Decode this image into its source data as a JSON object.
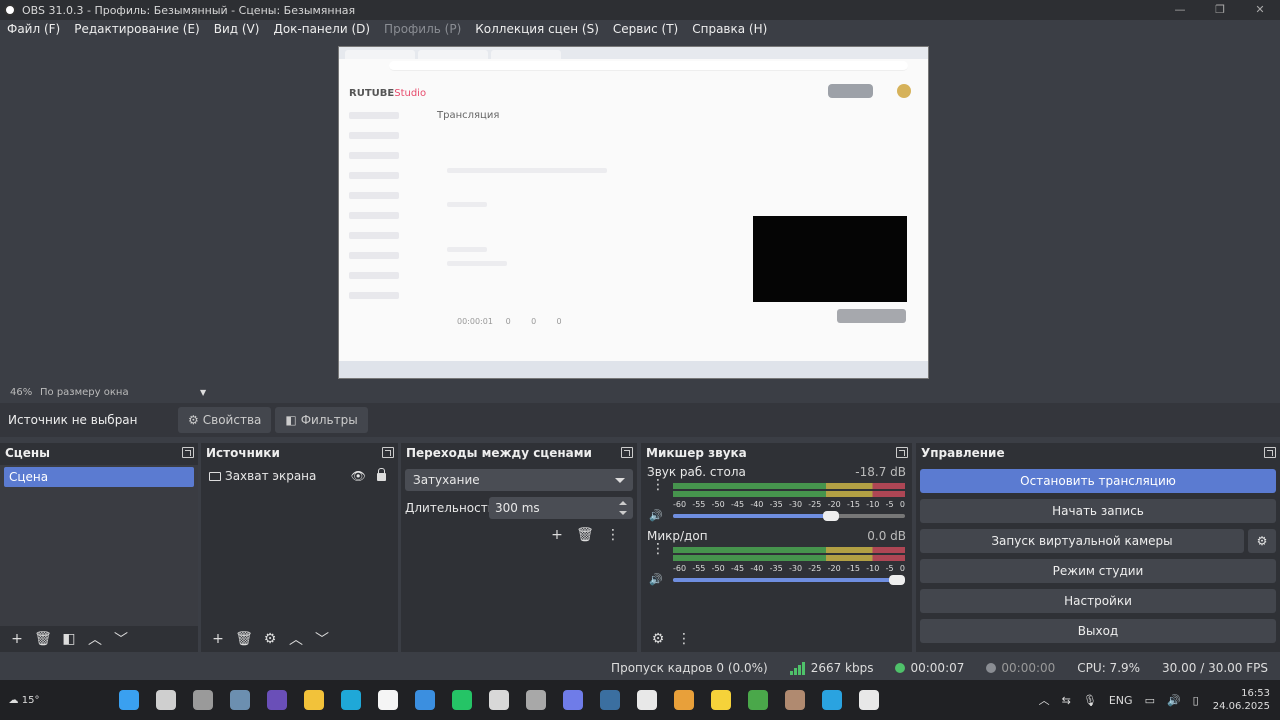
{
  "window": {
    "title": "OBS 31.0.3 - Профиль: Безымянный - Сцены: Безымянная",
    "minimize": "—",
    "maximize": "❐",
    "close": "✕"
  },
  "menu": [
    {
      "label": "Файл (F)",
      "disabled": false
    },
    {
      "label": "Редактирование (E)",
      "disabled": false
    },
    {
      "label": "Вид (V)",
      "disabled": false
    },
    {
      "label": "Док-панели (D)",
      "disabled": false
    },
    {
      "label": "Профиль (P)",
      "disabled": true
    },
    {
      "label": "Коллекция сцен (S)",
      "disabled": false
    },
    {
      "label": "Сервис (T)",
      "disabled": false
    },
    {
      "label": "Справка (H)",
      "disabled": false
    }
  ],
  "preview": {
    "logo_main": "RUTUBE",
    "logo_accent": "Studio",
    "heading": "Трансляция",
    "timer": "00:00:01",
    "counters": [
      "0",
      "0",
      "0"
    ]
  },
  "zoom": {
    "percent": "46%",
    "mode": "По размеру окна"
  },
  "source_bar": {
    "no_source": "Источник не выбран",
    "properties": "Свойства",
    "filters": "Фильтры"
  },
  "scenes": {
    "title": "Сцены",
    "items": [
      "Сцена"
    ]
  },
  "sources": {
    "title": "Источники",
    "items": [
      "Захват экрана"
    ]
  },
  "transitions": {
    "title": "Переходы между сценами",
    "selected": "Затухание",
    "duration_label": "Длительность",
    "duration_value": "300 ms"
  },
  "mixer": {
    "title": "Микшер звука",
    "ticks": [
      "-60",
      "-55",
      "-50",
      "-45",
      "-40",
      "-35",
      "-30",
      "-25",
      "-20",
      "-15",
      "-10",
      "-5",
      "0"
    ],
    "channels": [
      {
        "name": "Звук раб. стола",
        "db": "-18.7 dB",
        "volume": 0.68
      },
      {
        "name": "Микр/доп",
        "db": "0.0 dB",
        "volume": 1.0
      }
    ]
  },
  "controls": {
    "title": "Управление",
    "stop_stream": "Остановить трансляцию",
    "start_record": "Начать запись",
    "virtual_cam": "Запуск виртуальной камеры",
    "studio_mode": "Режим студии",
    "settings": "Настройки",
    "exit": "Выход"
  },
  "status": {
    "dropped": "Пропуск кадров 0 (0.0%)",
    "bitrate": "2667 kbps",
    "stream_time": "00:00:07",
    "record_time": "00:00:00",
    "cpu": "CPU: 7.9%",
    "fps": "30.00 / 30.00 FPS",
    "stream_color": "#4fc16a",
    "record_color": "#8a8d93"
  },
  "taskbar": {
    "temperature": "15°",
    "lang": "ENG",
    "time": "16:53",
    "date": "24.06.2025",
    "apps": [
      {
        "name": "start-icon",
        "color": "#3aa0f0"
      },
      {
        "name": "search-icon",
        "color": "#cfcfcf"
      },
      {
        "name": "task-view-icon",
        "color": "#9a9a9a"
      },
      {
        "name": "app-icon-1",
        "color": "#6c8fb0"
      },
      {
        "name": "app-icon-2",
        "color": "#6a4fb8"
      },
      {
        "name": "folder-icon",
        "color": "#f2c23a"
      },
      {
        "name": "edge-icon",
        "color": "#1fa8d8"
      },
      {
        "name": "yandex-icon",
        "color": "#f5f5f5"
      },
      {
        "name": "store-icon",
        "color": "#3b8fe0"
      },
      {
        "name": "whatsapp-icon",
        "color": "#25c466"
      },
      {
        "name": "app-icon-3",
        "color": "#d8d8d8"
      },
      {
        "name": "app-icon-4",
        "color": "#a8a8a8"
      },
      {
        "name": "discord-icon",
        "color": "#6f7ce8"
      },
      {
        "name": "steam-icon",
        "color": "#3b6fa0"
      },
      {
        "name": "app-icon-5",
        "color": "#e8e8e8"
      },
      {
        "name": "app-icon-6",
        "color": "#e8a03a"
      },
      {
        "name": "app-icon-7",
        "color": "#f5d23a"
      },
      {
        "name": "minecraft-icon",
        "color": "#4aa84a"
      },
      {
        "name": "app-icon-8",
        "color": "#b08a70"
      },
      {
        "name": "telegram-icon",
        "color": "#2aa3e0"
      },
      {
        "name": "obs-icon",
        "color": "#e8e8e8"
      }
    ]
  }
}
